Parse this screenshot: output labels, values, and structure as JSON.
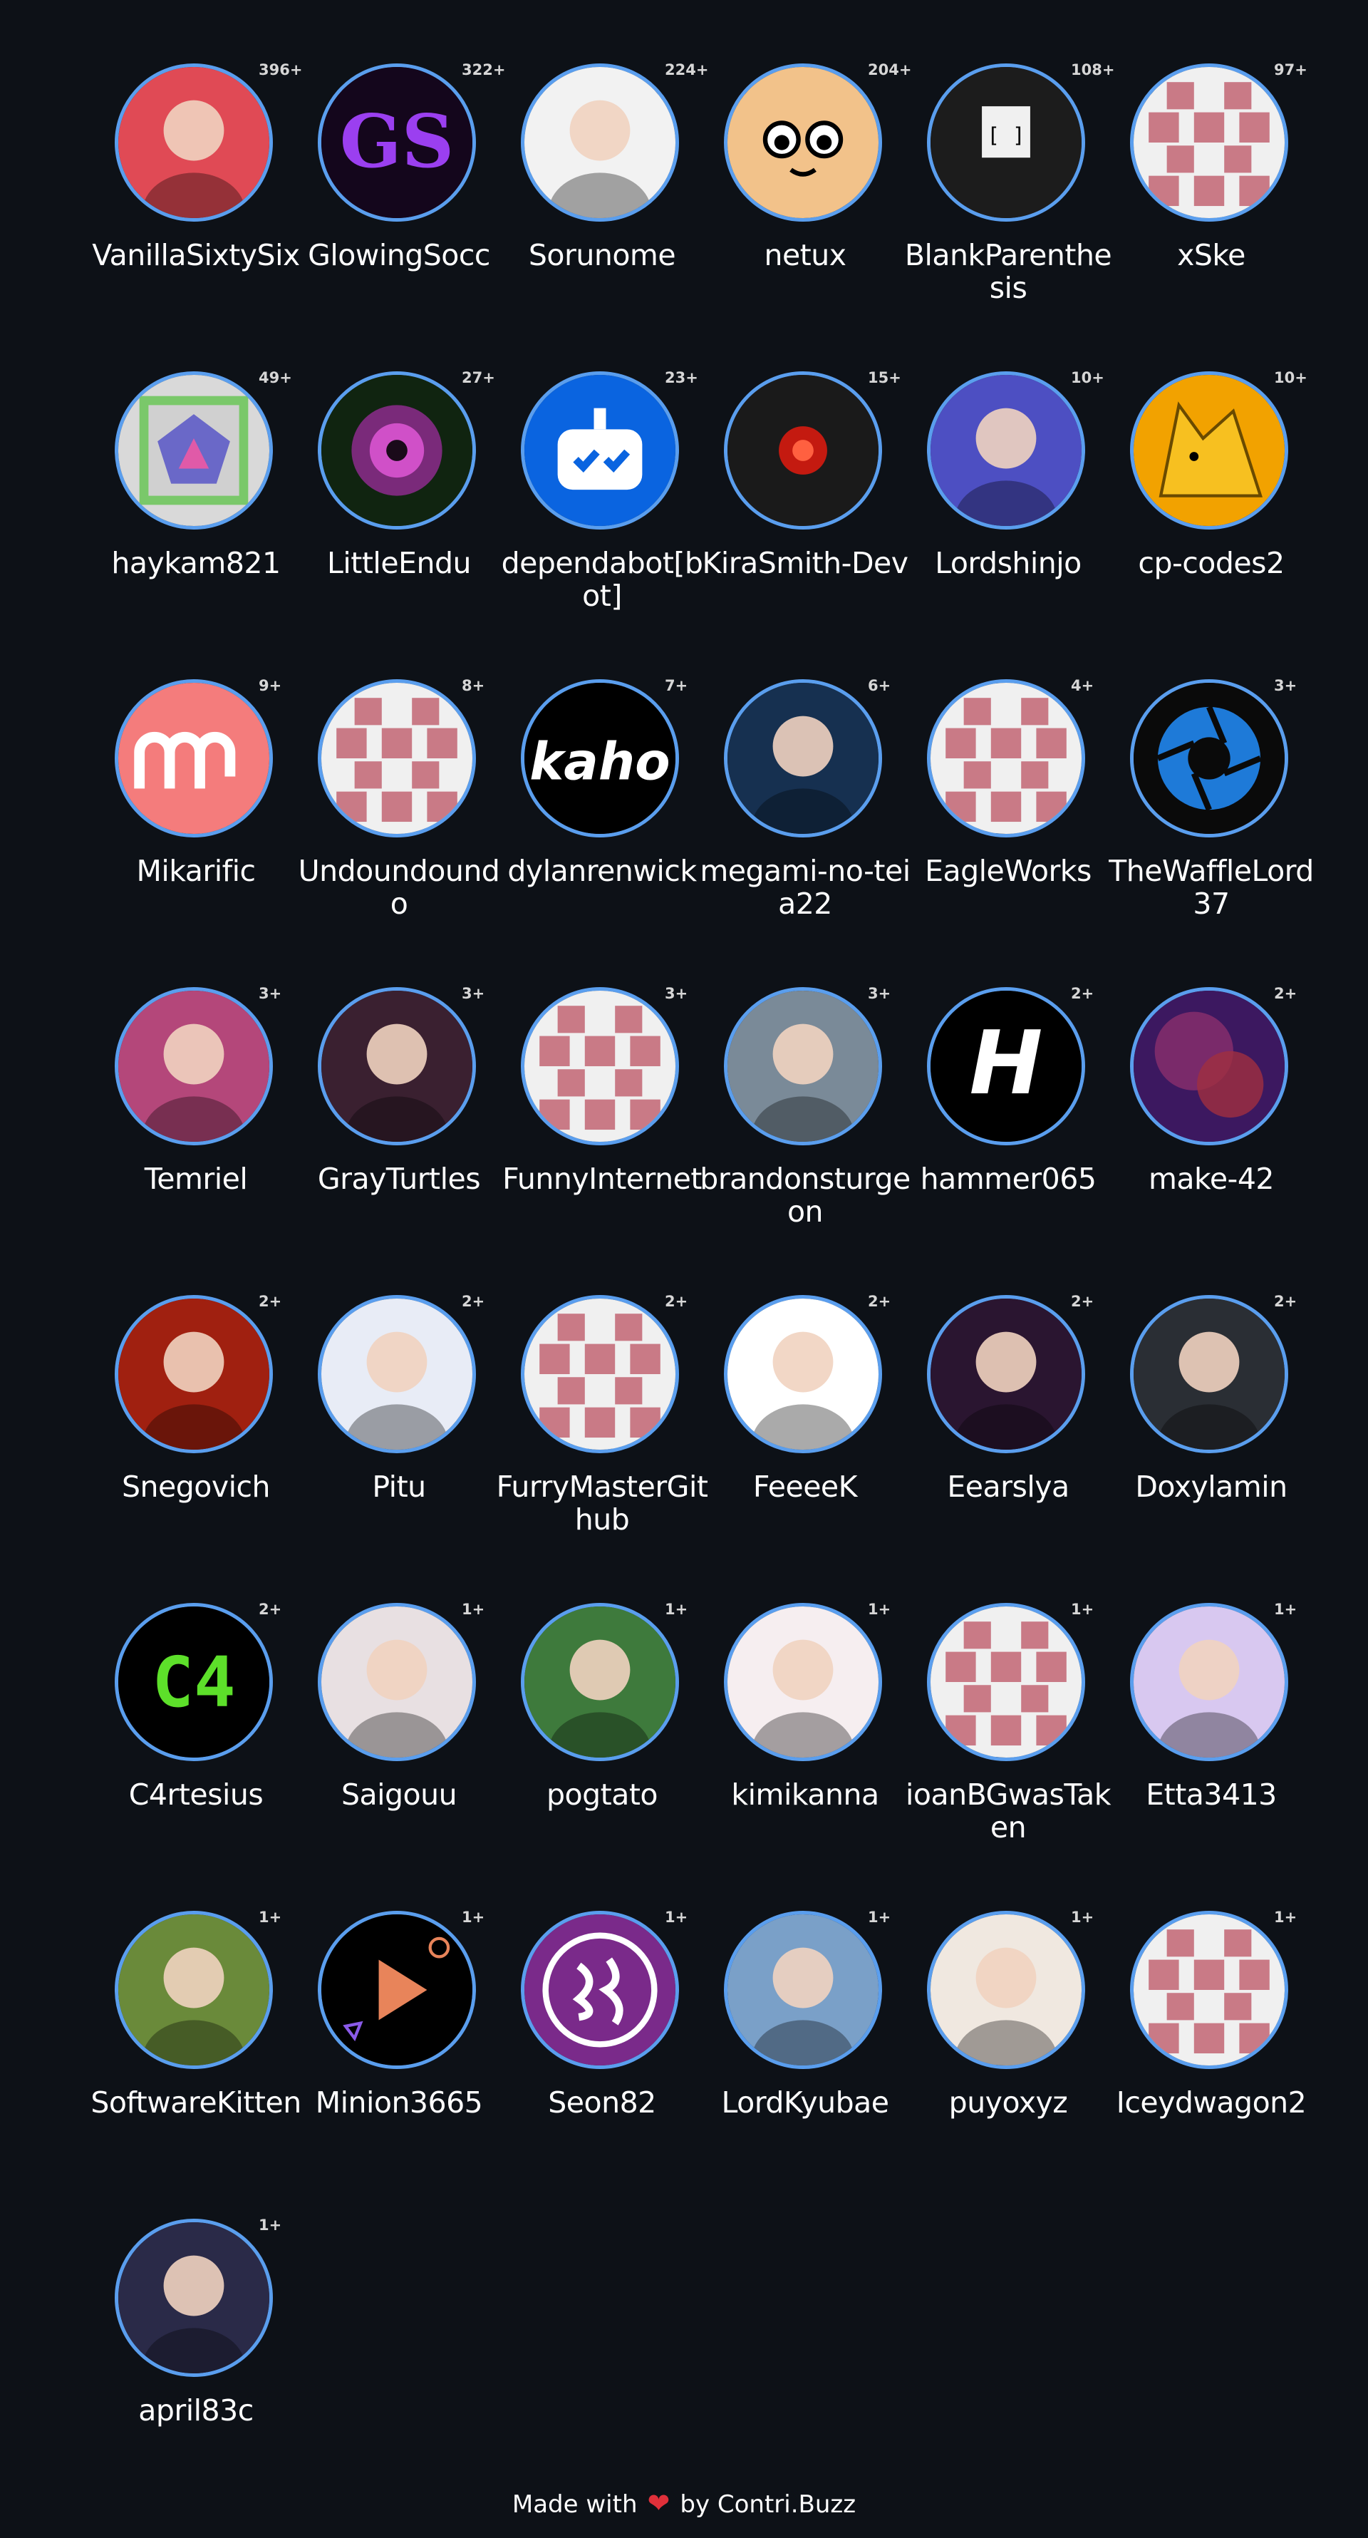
{
  "contributors": [
    {
      "name": "VanillaSixtySix",
      "count": "396+",
      "icon": "anime-girl-icon",
      "bg": "#e04a55"
    },
    {
      "name": "GlowingSocc",
      "count": "322+",
      "icon": "gs-logo-icon",
      "bg": "#14061c"
    },
    {
      "name": "Sorunome",
      "count": "224+",
      "icon": "pony-icon",
      "bg": "#f2f2f2"
    },
    {
      "name": "netux",
      "count": "204+",
      "icon": "cartoon-face-icon",
      "bg": "#f2c28a"
    },
    {
      "name": "BlankParenthesis",
      "count": "108+",
      "icon": "monochrome-figure-icon",
      "bg": "#1c1c1c"
    },
    {
      "name": "xSke",
      "count": "97+",
      "icon": "identicon-icon",
      "bg": "#f0f0f0"
    },
    {
      "name": "haykam821",
      "count": "49+",
      "icon": "pentagon-icon",
      "bg": "#d9d9d9"
    },
    {
      "name": "LittleEndu",
      "count": "27+",
      "icon": "mandala-icon",
      "bg": "#102410"
    },
    {
      "name": "dependabot[bot]",
      "count": "23+",
      "icon": "robot-icon",
      "bg": "#0a64e0"
    },
    {
      "name": "KiraSmith-Dev",
      "count": "15+",
      "icon": "red-eye-icon",
      "bg": "#1a1a1a"
    },
    {
      "name": "Lordshinjo",
      "count": "10+",
      "icon": "anime-blue-hair-icon",
      "bg": "#4d4fc2"
    },
    {
      "name": "cp-codes2",
      "count": "10+",
      "icon": "fox-icon",
      "bg": "#f2a200"
    },
    {
      "name": "Mikarific",
      "count": "9+",
      "icon": "logo-mr-icon",
      "bg": "#f47c7c"
    },
    {
      "name": "Undoundoundo",
      "count": "8+",
      "icon": "identicon-icon",
      "bg": "#f0f0f0"
    },
    {
      "name": "dylanrenwick",
      "count": "7+",
      "icon": "kaho-logo-icon",
      "bg": "#000000"
    },
    {
      "name": "megami-no-teia22",
      "count": "6+",
      "icon": "blue-character-icon",
      "bg": "#163050"
    },
    {
      "name": "EagleWorks",
      "count": "4+",
      "icon": "identicon-icon",
      "bg": "#f0f0f0"
    },
    {
      "name": "TheWaffleLord37",
      "count": "3+",
      "icon": "aperture-icon",
      "bg": "#0a0a0a"
    },
    {
      "name": "Temriel",
      "count": "3+",
      "icon": "anime-pink-icon",
      "bg": "#b4477a"
    },
    {
      "name": "GrayTurtles",
      "count": "3+",
      "icon": "retro-character-icon",
      "bg": "#3a2030"
    },
    {
      "name": "FunnyInternet",
      "count": "3+",
      "icon": "identicon-icon",
      "bg": "#f0f0f0"
    },
    {
      "name": "brandonsturgeon",
      "count": "3+",
      "icon": "person-photo-icon",
      "bg": "#7a8a98"
    },
    {
      "name": "hammer065",
      "count": "2+",
      "icon": "h-logo-icon",
      "bg": "#000000"
    },
    {
      "name": "make-42",
      "count": "2+",
      "icon": "nebula-icon",
      "bg": "#3c1860"
    },
    {
      "name": "Snegovich",
      "count": "2+",
      "icon": "red-creature-icon",
      "bg": "#a02010"
    },
    {
      "name": "Pitu",
      "count": "2+",
      "icon": "anime-green-hoodie-icon",
      "bg": "#e8ecf6"
    },
    {
      "name": "FurryMasterGithub",
      "count": "2+",
      "icon": "identicon-icon",
      "bg": "#f0f0f0"
    },
    {
      "name": "FeeeeK",
      "count": "2+",
      "icon": "anime-red-circle-icon",
      "bg": "#ffffff"
    },
    {
      "name": "Eearslya",
      "count": "2+",
      "icon": "demon-icon",
      "bg": "#2a1530"
    },
    {
      "name": "Doxylamin",
      "count": "2+",
      "icon": "man-photo-icon",
      "bg": "#2a2e34"
    },
    {
      "name": "C4rtesius",
      "count": "2+",
      "icon": "c4-logo-icon",
      "bg": "#000000"
    },
    {
      "name": "Saigouu",
      "count": "1+",
      "icon": "cat-photo-icon",
      "bg": "#e8e0e2"
    },
    {
      "name": "pogtato",
      "count": "1+",
      "icon": "hamster-photo-icon",
      "bg": "#3e7a3c"
    },
    {
      "name": "kimikanna",
      "count": "1+",
      "icon": "anime-flowers-icon",
      "bg": "#f6eef0"
    },
    {
      "name": "ioanBGwasTaken",
      "count": "1+",
      "icon": "identicon-icon",
      "bg": "#f0f0f0"
    },
    {
      "name": "Etta3413",
      "count": "1+",
      "icon": "purple-fox-icon",
      "bg": "#d8c8f0"
    },
    {
      "name": "SoftwareKitten",
      "count": "1+",
      "icon": "llama-photo-icon",
      "bg": "#6a8a3a"
    },
    {
      "name": "Minion3665",
      "count": "1+",
      "icon": "play-logo-icon",
      "bg": "#000000"
    },
    {
      "name": "Seon82",
      "count": "1+",
      "icon": "purple-emblem-icon",
      "bg": "#7a2a8a"
    },
    {
      "name": "LordKyubae",
      "count": "1+",
      "icon": "bearded-cartoon-icon",
      "bg": "#7aa0c8"
    },
    {
      "name": "puyoxyz",
      "count": "1+",
      "icon": "glasses-girl-icon",
      "bg": "#f0e8e0"
    },
    {
      "name": "Iceydwagon2",
      "count": "1+",
      "icon": "identicon-icon",
      "bg": "#f0f0f0"
    },
    {
      "name": "april83c",
      "count": "1+",
      "icon": "anime-dark-hair-icon",
      "bg": "#2a2a48"
    }
  ],
  "footer": {
    "made_with": "Made with",
    "heart": "❤",
    "by": "by Contri.Buzz"
  }
}
